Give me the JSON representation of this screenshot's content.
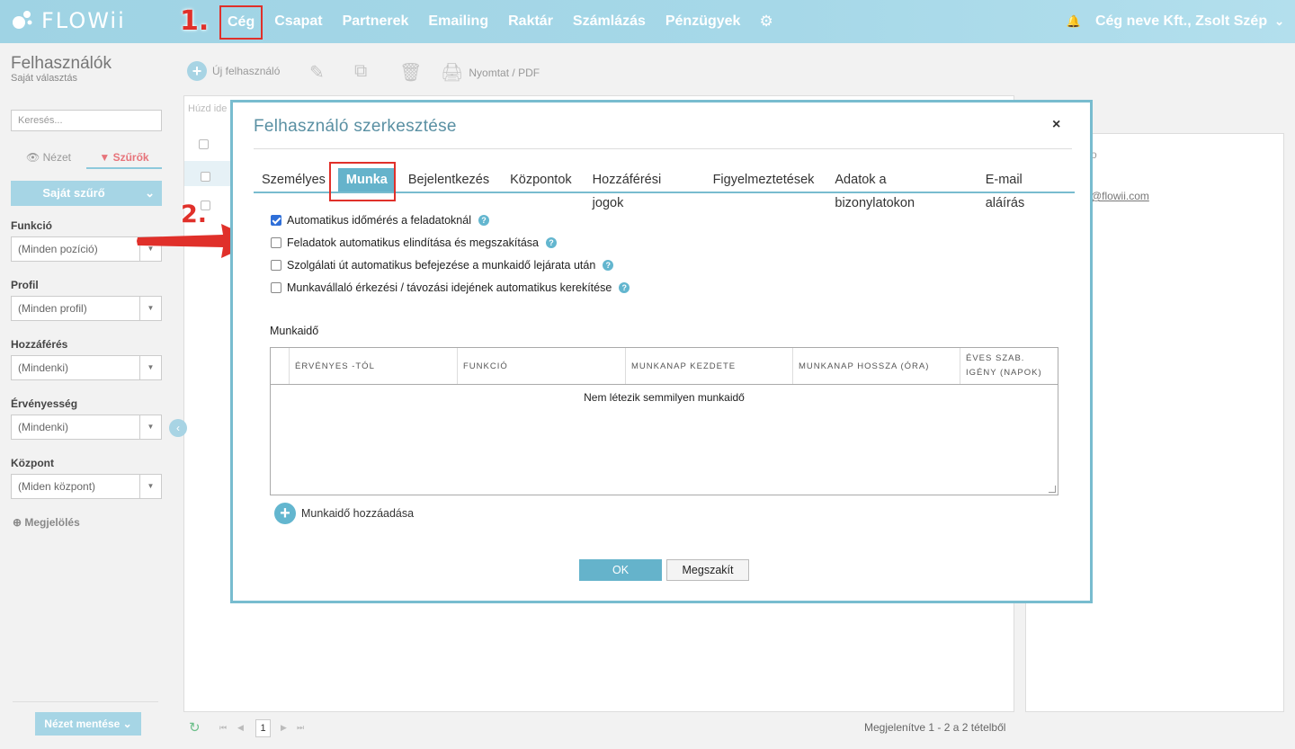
{
  "app": {
    "logo_text": "FLOWii"
  },
  "nav": {
    "items": [
      "Cég",
      "Csapat",
      "Partnerek",
      "Emailing",
      "Raktár",
      "Számlázás",
      "Pénzügyek"
    ],
    "company_user": "Cég neve Kft., Zsolt Szép"
  },
  "annotations": {
    "step1": "1.",
    "step2": "2.",
    "highlight_color": "#e0302a"
  },
  "sidebar": {
    "title": "Felhasználók",
    "subtitle": "Saját választás",
    "search_placeholder": "Keresés...",
    "view_tab": "Nézet",
    "filter_tab": "Szűrők",
    "own_filter": "Saját szűrő",
    "filters": [
      {
        "label": "Funkció",
        "value": "(Minden pozíció)"
      },
      {
        "label": "Profil",
        "value": "(Minden profil)"
      },
      {
        "label": "Hozzáférés",
        "value": "(Mindenki)"
      },
      {
        "label": "Érvényesség",
        "value": "(Mindenki)"
      },
      {
        "label": "Központ",
        "value": "(Miden központ)"
      }
    ],
    "markers": "Megjelölés",
    "save_view": "Nézet mentése"
  },
  "toolbar": {
    "new_user": "Új felhasználó",
    "print": "Nyomtat / PDF"
  },
  "list": {
    "drag_hint": "Húzd ide",
    "pager_page": "1",
    "pager_info": "Megjelenítve 1 - 2 a 2 tételből"
  },
  "detail": {
    "email_fragment": "@flowii.com",
    "top_fragment": "o"
  },
  "modal": {
    "title": "Felhasználó szerkesztése",
    "close": "×",
    "tabs": [
      "Személyes",
      "Munka",
      "Bejelentkezés",
      "Központok",
      "Hozzáférési jogok",
      "Figyelmeztetések",
      "Adatok a bizonylatokon",
      "E-mail aláírás"
    ],
    "active_tab": "Munka",
    "options": [
      {
        "label": "Automatikus időmérés a feladatoknál",
        "checked": true
      },
      {
        "label": "Feladatok automatikus elindítása és megszakítása",
        "checked": false
      },
      {
        "label": "Szolgálati út automatikus befejezése a munkaidő lejárata után",
        "checked": false
      },
      {
        "label": "Munkavállaló érkezési / távozási idejének automatikus kerekítése",
        "checked": false
      }
    ],
    "help_glyph": "?",
    "worktime": {
      "label": "Munkaidő",
      "columns": [
        "ÉRVÉNYES -TÓL",
        "FUNKCIÓ",
        "MUNKANAP KEZDETE",
        "MUNKANAP HOSSZA (ÓRA)",
        "ÉVES SZAB. IGÉNY (NAPOK)"
      ],
      "empty": "Nem létezik semmilyen munkaidő",
      "add": "Munkaidő hozzáadása"
    },
    "ok": "OK",
    "cancel": "Megszakít"
  }
}
